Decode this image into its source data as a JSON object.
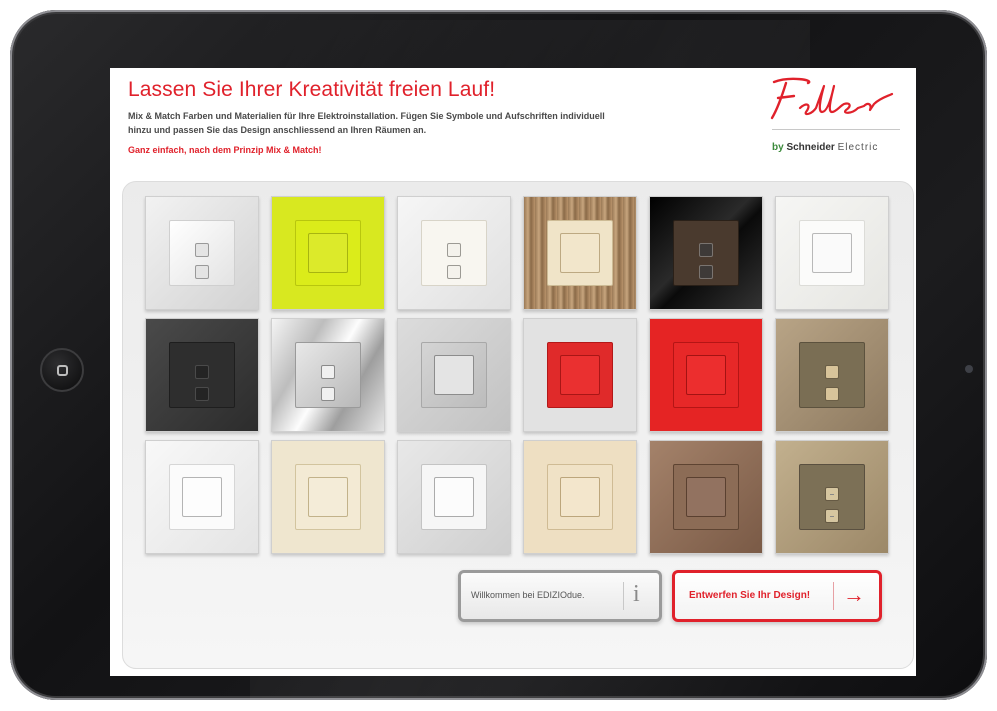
{
  "header": {
    "headline": "Lassen Sie Ihrer Kreativität freien Lauf!",
    "intro_line1": "Mix & Match Farben und Materialien für Ihre Elektroinstallation. Fügen Sie Symbole und Aufschriften individuell",
    "intro_line2": "hinzu und passen Sie das Design anschliessend an Ihren Räumen an.",
    "slogan": "Ganz einfach, nach dem Prinzip Mix & Match!"
  },
  "logo": {
    "wordmark": "Feller",
    "by": "by",
    "company": "Schneider",
    "company_suffix": "Electric"
  },
  "buttons": {
    "welcome_label": "Willkommen bei EDIZIOdue.",
    "welcome_icon": "i",
    "design_label": "Entwerfen Sie Ihr Design!",
    "design_icon": "→"
  },
  "colors": {
    "brand_red": "#e0212b",
    "frame": "#1a1a1c",
    "logo_green": "#3b8a3b"
  },
  "icons": [
    "home-button-icon",
    "info-icon",
    "arrow-right-icon",
    "front-camera"
  ]
}
